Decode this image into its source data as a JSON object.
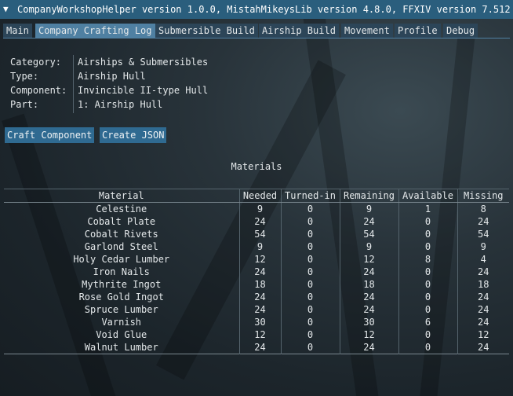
{
  "window": {
    "title": "CompanyWorkshopHelper version 1.0.0, MistahMikeysLib version 4.8.0, FFXIV version 7.512"
  },
  "tabs": [
    {
      "label": "Main"
    },
    {
      "label": "Company Crafting Log"
    },
    {
      "label": "Submersible Build"
    },
    {
      "label": "Airship Build"
    },
    {
      "label": "Movement"
    },
    {
      "label": "Profile"
    },
    {
      "label": "Debug"
    }
  ],
  "active_tab": "Company Crafting Log",
  "info": {
    "category_label": "Category:",
    "category_value": "Airships & Submersibles",
    "type_label": "Type:",
    "type_value": "Airship Hull",
    "component_label": "Component:",
    "component_value": "Invincible II-type Hull",
    "part_label": "Part:",
    "part_value": "1: Airship Hull"
  },
  "buttons": {
    "craft_component": "Craft Component",
    "create_json": "Create JSON"
  },
  "materials": {
    "title": "Materials",
    "columns": [
      "Material",
      "Needed",
      "Turned-in",
      "Remaining",
      "Available",
      "Missing"
    ],
    "rows": [
      [
        "Celestine",
        "9",
        "0",
        "9",
        "1",
        "8"
      ],
      [
        "Cobalt Plate",
        "24",
        "0",
        "24",
        "0",
        "24"
      ],
      [
        "Cobalt Rivets",
        "54",
        "0",
        "54",
        "0",
        "54"
      ],
      [
        "Garlond Steel",
        "9",
        "0",
        "9",
        "0",
        "9"
      ],
      [
        "Holy Cedar Lumber",
        "12",
        "0",
        "12",
        "8",
        "4"
      ],
      [
        "Iron Nails",
        "24",
        "0",
        "24",
        "0",
        "24"
      ],
      [
        "Mythrite Ingot",
        "18",
        "0",
        "18",
        "0",
        "18"
      ],
      [
        "Rose Gold Ingot",
        "24",
        "0",
        "24",
        "0",
        "24"
      ],
      [
        "Spruce Lumber",
        "24",
        "0",
        "24",
        "0",
        "24"
      ],
      [
        "Varnish",
        "30",
        "0",
        "30",
        "6",
        "24"
      ],
      [
        "Void Glue",
        "12",
        "0",
        "12",
        "0",
        "12"
      ],
      [
        "Walnut Lumber",
        "24",
        "0",
        "24",
        "0",
        "24"
      ]
    ]
  },
  "colors": {
    "titlebar": "#2a5e7d",
    "tab_active": "#4f80a2",
    "tab_inactive": "#2c4558",
    "button": "#2f6a91"
  }
}
